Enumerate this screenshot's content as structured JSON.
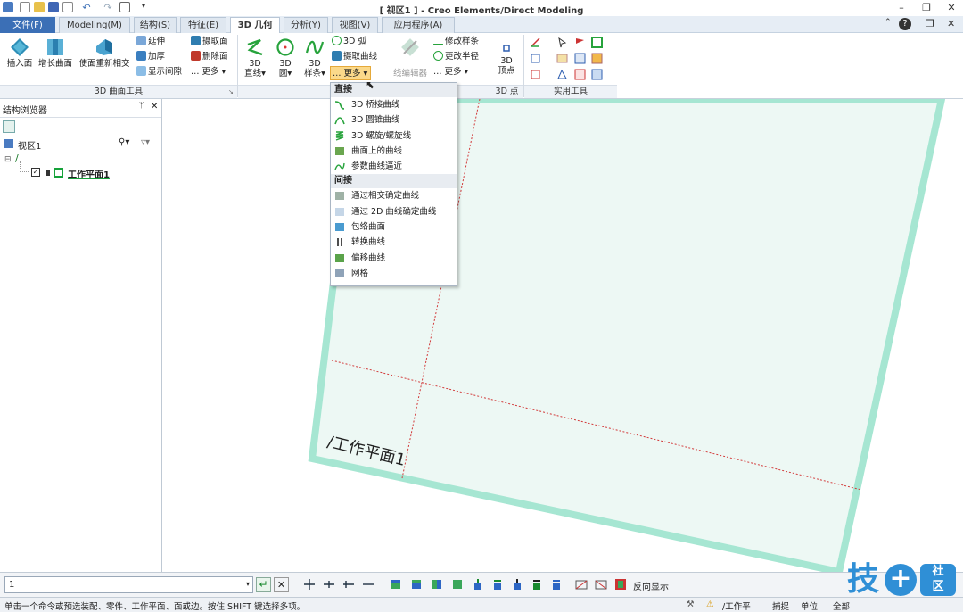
{
  "window": {
    "title": "[ 视区1 ] - Creo Elements/Direct Modeling"
  },
  "tabs": [
    "文件(F)",
    "Modeling(M)",
    "结构(S)",
    "特征(E)",
    "3D 几何",
    "分析(Y)",
    "视图(V)",
    "应用程序(A)"
  ],
  "active_tab": "3D 几何",
  "ribbon": {
    "surface_group": {
      "label": "3D 曲面工具",
      "buttons": [
        "插入面",
        "增长曲面",
        "使面重新相交"
      ],
      "small": [
        "延伸",
        "加厚",
        "显示间隙"
      ],
      "small2": [
        "摄取面",
        "删除面",
        "更多"
      ]
    },
    "curve_group": {
      "big": [
        {
          "line1": "3D",
          "line2": "直线"
        },
        {
          "line1": "3D",
          "line2": "圆"
        },
        {
          "line1": "3D",
          "line2": "样条"
        }
      ],
      "small": [
        "3D 弧",
        "摄取曲线",
        "更多"
      ],
      "wire_editor": "线编辑器",
      "small2": [
        "修改样条",
        "更改半径",
        "更多"
      ]
    },
    "point_group": {
      "label": "3D 点",
      "line1": "3D",
      "line2": "顶点"
    },
    "util_group": {
      "label": "实用工具"
    }
  },
  "dropdown": {
    "header1": "直接",
    "direct_items": [
      "3D 桥接曲线",
      "3D 圆锥曲线",
      "3D 螺旋/螺旋线",
      "曲面上的曲线",
      "参数曲线逼近"
    ],
    "header2": "间接",
    "indirect_items": [
      "通过相交确定曲线",
      "通过 2D 曲线确定曲线",
      "包络曲面",
      "转换曲线",
      "偏移曲线",
      "网格"
    ]
  },
  "sidebar": {
    "title": "结构浏览器",
    "viewport_label": "视区1",
    "tree_item": "工作平面1"
  },
  "viewport": {
    "plane_label": "/工作平面1"
  },
  "bottom": {
    "command_input": "1",
    "reverse_display": "反向显示"
  },
  "status": {
    "hint": "单击一个命令或预选装配、零件、工作平面、面或边。按住 SHIFT 键选择多项。",
    "workplane": "/工作平",
    "snap": "捕捉",
    "unit": "单位",
    "all": "全部"
  },
  "colors": {
    "plane_fill": "#edf8f4",
    "plane_border": "#a6e6d2",
    "accent": "#3b6fb6",
    "tab_active": "#ffffff"
  },
  "watermark": {
    "text": "技术社区"
  }
}
